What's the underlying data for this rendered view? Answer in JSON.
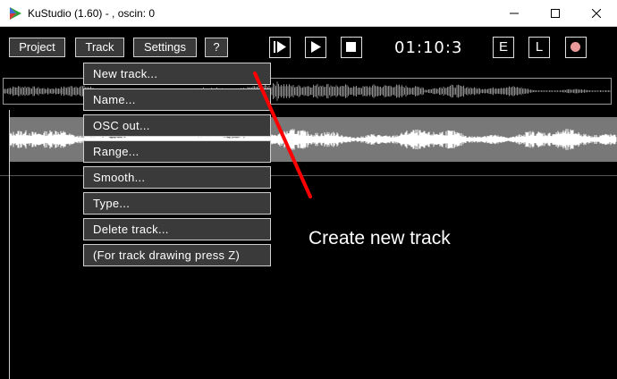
{
  "window": {
    "title": "KuStudio (1.60) - , oscin: 0"
  },
  "toolbar": {
    "project_label": "Project",
    "track_label": "Track",
    "settings_label": "Settings",
    "help_label": "?",
    "timecode": "01:10:3",
    "e_label": "E",
    "l_label": "L"
  },
  "track_menu": {
    "items": [
      {
        "label": "New track..."
      },
      {
        "label": "Name..."
      },
      {
        "label": "OSC out..."
      },
      {
        "label": "Range..."
      },
      {
        "label": "Smooth..."
      },
      {
        "label": "Type..."
      },
      {
        "label": "Delete track..."
      },
      {
        "label": "(For track drawing press Z)"
      }
    ]
  },
  "annotation": {
    "text": "Create new track",
    "color": "#ff0000"
  },
  "colors": {
    "record_dot": "#e89a9a",
    "track_bg": "#787878",
    "waveform": "#ffffff",
    "overview_wave": "#8a8a8a"
  },
  "icons": [
    "app-icon",
    "minimize-icon",
    "maximize-icon",
    "close-icon",
    "play-from-start-icon",
    "play-icon",
    "stop-icon",
    "record-icon"
  ]
}
